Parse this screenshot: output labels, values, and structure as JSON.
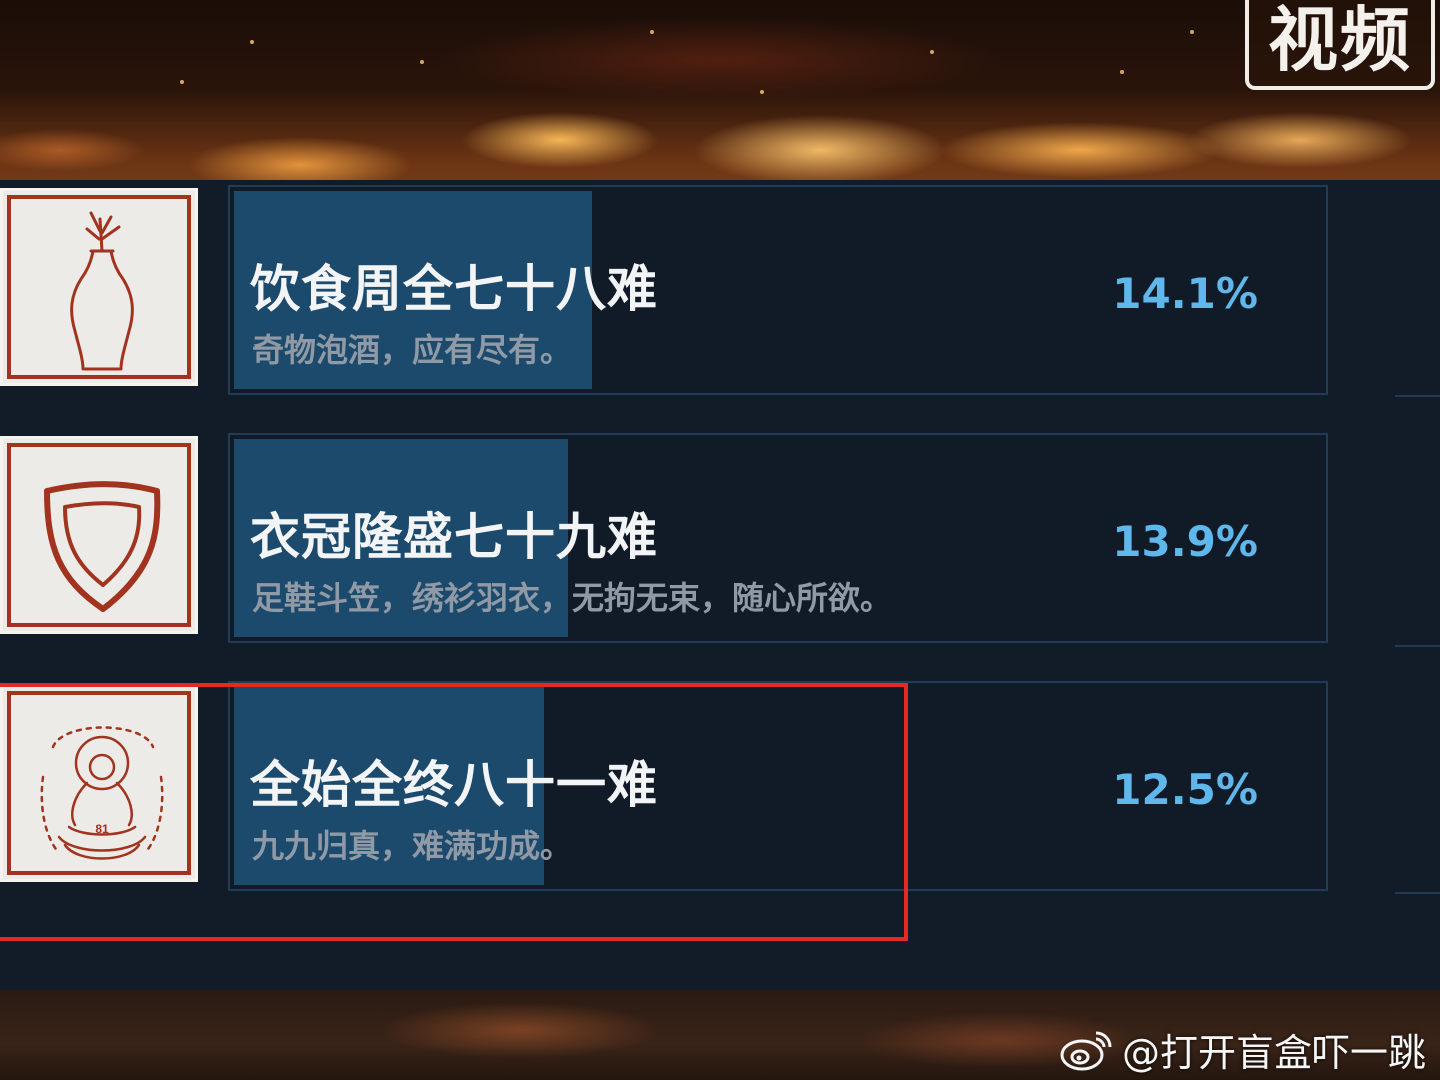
{
  "video_badge": "视频",
  "watermark": {
    "icon": "weibo-icon",
    "handle": "@打开盲盒吓一跳"
  },
  "achievements": [
    {
      "title": "饮食周全七十八难",
      "description": "奇物泡酒，应有尽有。",
      "percent_label": "14.1%",
      "percent": 14.1,
      "icon": "vase-icon"
    },
    {
      "title": "衣冠隆盛七十九难",
      "description": "足鞋斗笠，绣衫羽衣，无拘无束，随心所欲。",
      "percent_label": "13.9%",
      "percent": 13.9,
      "icon": "shield-icon"
    },
    {
      "title": "全始全终八十一难",
      "description": "九九归真，难满功成。",
      "percent_label": "12.5%",
      "percent": 12.5,
      "icon": "meditating-figure-icon",
      "icon_text": "81",
      "highlighted": true
    }
  ],
  "colors": {
    "panel": "#121c28",
    "progress": "#1c4a6c",
    "percent": "#5fb7ec",
    "icon_frame": "#a2331f",
    "highlight": "#e52a22"
  }
}
